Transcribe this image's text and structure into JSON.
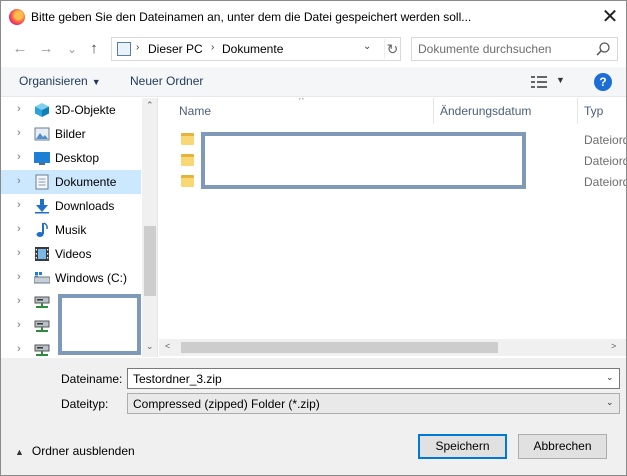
{
  "window": {
    "title": "Bitte geben Sie den Dateinamen an, unter dem die Datei gespeichert werden soll...",
    "close_glyph": "✕"
  },
  "nav_buttons": {
    "back": "←",
    "forward": "→",
    "recent": "⌄",
    "up": "↑"
  },
  "address": {
    "separator": "›",
    "segments": [
      "Dieser PC",
      "Dokumente"
    ],
    "dropdown_glyph": "⌄",
    "refresh_glyph": "↻"
  },
  "search": {
    "placeholder": "Dokumente durchsuchen"
  },
  "toolbar": {
    "organize_label": "Organisieren",
    "organize_caret": "▼",
    "new_folder_label": "Neuer Ordner",
    "view_caret": "▼",
    "help_glyph": "?"
  },
  "nav_pane": {
    "chevron": "›",
    "items": [
      {
        "label": "3D-Objekte",
        "icon": "cube-3d-icon",
        "selected": false
      },
      {
        "label": "Bilder",
        "icon": "pictures-icon",
        "selected": false
      },
      {
        "label": "Desktop",
        "icon": "desktop-icon",
        "selected": false
      },
      {
        "label": "Dokumente",
        "icon": "documents-icon",
        "selected": true
      },
      {
        "label": "Downloads",
        "icon": "downloads-icon",
        "selected": false
      },
      {
        "label": "Musik",
        "icon": "music-icon",
        "selected": false
      },
      {
        "label": "Videos",
        "icon": "videos-icon",
        "selected": false
      },
      {
        "label": "Windows (C:)",
        "icon": "drive-icon",
        "selected": false
      },
      {
        "label": "",
        "icon": "network-drive-icon",
        "selected": false
      },
      {
        "label": "",
        "icon": "network-drive-icon",
        "selected": false
      },
      {
        "label": "",
        "icon": "network-drive-icon",
        "selected": false
      }
    ],
    "scroll_up": "⌃",
    "scroll_down": "⌄"
  },
  "file_list": {
    "sort_caret": "^",
    "columns": {
      "name": "Name",
      "date": "Änderungsdatum",
      "type": "Typ"
    },
    "rows": [
      {
        "type": "Dateiordner"
      },
      {
        "type": "Dateiordner"
      },
      {
        "type": "Dateiordner"
      }
    ],
    "scroll_left": "<",
    "scroll_right": ">"
  },
  "form": {
    "filename_label": "Dateiname:",
    "filename_value": "Testordner_3.zip",
    "filetype_label": "Dateityp:",
    "filetype_value": "Compressed (zipped) Folder (*.zip)",
    "caret": "⌄"
  },
  "footer": {
    "hide_caret": "▲",
    "hide_label": "Ordner ausblenden",
    "save_label": "Speichern",
    "cancel_label": "Abbrechen"
  },
  "colors": {
    "selected_bg": "#cce8ff",
    "accent": "#0078d7",
    "redaction_border": "#7f99b8",
    "help_blue": "#1c6ed6"
  }
}
